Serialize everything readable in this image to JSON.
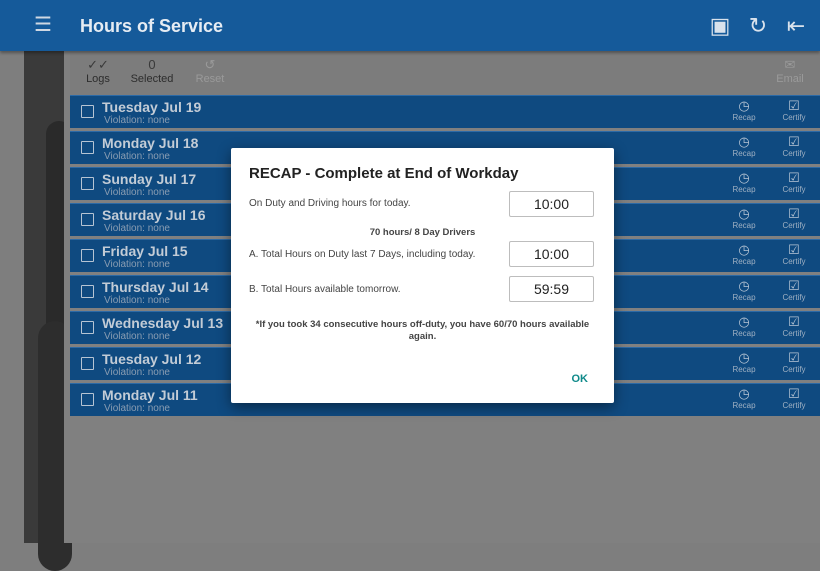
{
  "appbar": {
    "title": "Hours of Service",
    "icons": [
      "menu-icon",
      "sync-device-icon",
      "refresh-icon",
      "logout-icon"
    ]
  },
  "toolbar": {
    "logs_label": "Logs",
    "selected_count": "0",
    "selected_label": "Selected",
    "reset_label": "Reset",
    "email_label": "Email"
  },
  "logs": [
    {
      "date": "Tuesday Jul 19",
      "violation": "Violation: none"
    },
    {
      "date": "Monday Jul 18",
      "violation": "Violation: none"
    },
    {
      "date": "Sunday Jul 17",
      "violation": "Violation: none"
    },
    {
      "date": "Saturday Jul 16",
      "violation": "Violation: none"
    },
    {
      "date": "Friday Jul 15",
      "violation": "Violation: none"
    },
    {
      "date": "Thursday Jul 14",
      "violation": "Violation: none"
    },
    {
      "date": "Wednesday Jul 13",
      "violation": "Violation: none"
    },
    {
      "date": "Tuesday Jul 12",
      "violation": "Violation: none"
    },
    {
      "date": "Monday Jul 11",
      "violation": "Violation: none"
    }
  ],
  "row_actions": {
    "recap_label": "Recap",
    "certify_label": "Certify"
  },
  "dialog": {
    "title": "RECAP - Complete at End of Workday",
    "line1_label": "On Duty and Driving hours for today.",
    "line1_value": "10:00",
    "rule_label": "70 hours/ 8 Day Drivers",
    "lineA_label": "A. Total Hours on Duty last 7 Days, including today.",
    "lineA_value": "10:00",
    "lineB_label": "B. Total Hours available tomorrow.",
    "lineB_value": "59:59",
    "note": "*If you took 34 consecutive hours off-duty, you have 60/70 hours available again.",
    "ok_label": "OK"
  },
  "colors": {
    "appbar": "#155a9a",
    "row": "#0f4a80",
    "ok": "#0f8a8a"
  }
}
